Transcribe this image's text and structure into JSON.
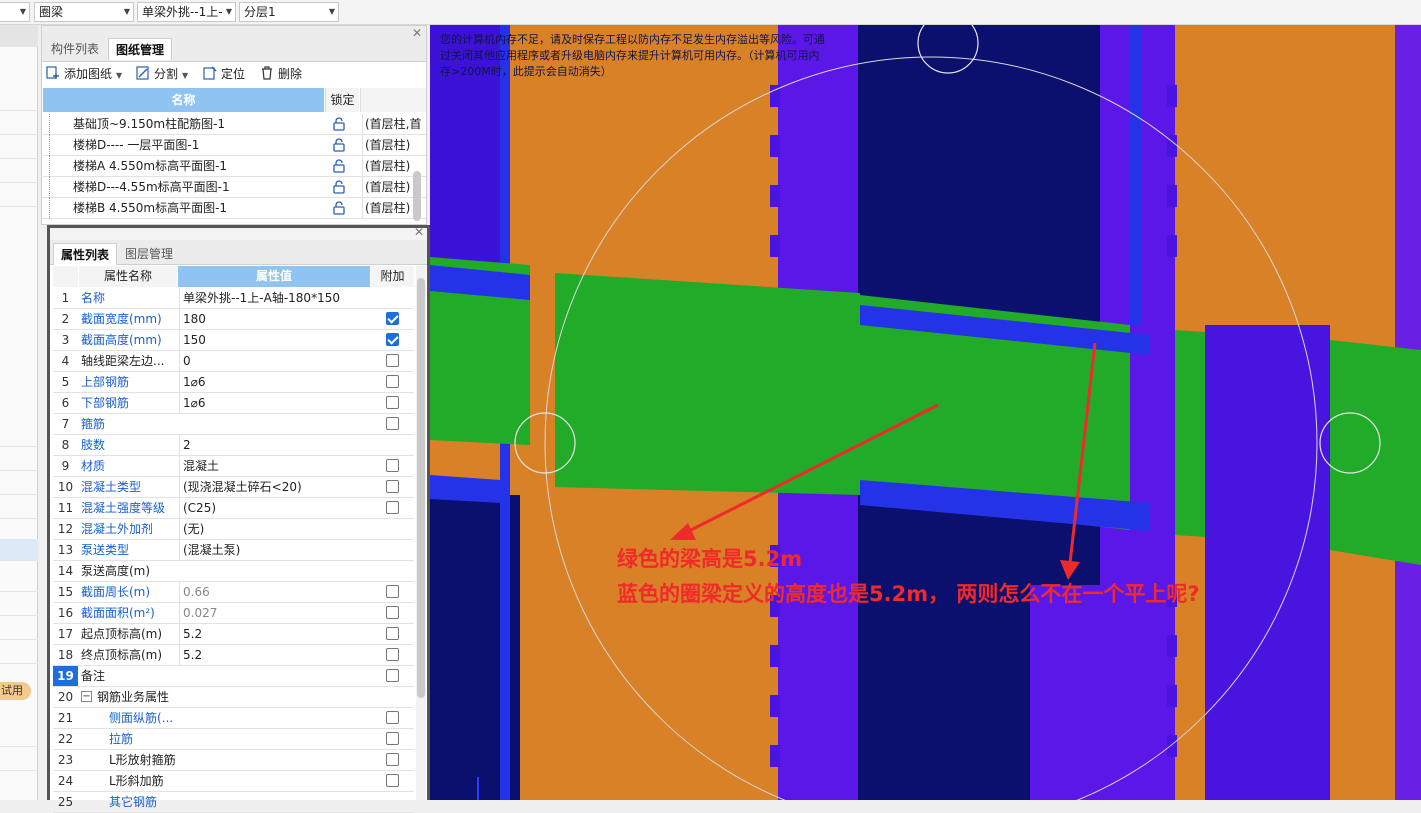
{
  "toolbar": {
    "dropdowns": [
      "",
      "圈梁",
      "单梁外挑--1上-",
      "分层1"
    ]
  },
  "left_strip": {
    "trial_badge": "试用"
  },
  "drawing_panel": {
    "tabs": [
      "构件列表",
      "图纸管理"
    ],
    "active_tab": "图纸管理",
    "actions": [
      {
        "label": "添加图纸",
        "icon": "add-drawing-icon"
      },
      {
        "label": "分割",
        "icon": "split-icon"
      },
      {
        "label": "定位",
        "icon": "locate-icon"
      },
      {
        "label": "删除",
        "icon": "delete-icon"
      }
    ],
    "columns": [
      "名称",
      "锁定",
      ""
    ],
    "rows": [
      {
        "name": "基础顶~9.150m柱配筋图-1",
        "extra": "(首层柱,首"
      },
      {
        "name": "楼梯D---- 一层平面图-1",
        "extra": "(首层柱)"
      },
      {
        "name": "楼梯A 4.550m标高平面图-1",
        "extra": "(首层柱)"
      },
      {
        "name": "楼梯D---4.55m标高平面图-1",
        "extra": "(首层柱)"
      },
      {
        "name": "楼梯B 4.550m标高平面图-1",
        "extra": "(首层柱)"
      }
    ]
  },
  "property_panel": {
    "tabs": [
      "属性列表",
      "图层管理"
    ],
    "active_tab": "属性列表",
    "columns": [
      "属性名称",
      "属性值",
      "附加"
    ],
    "rows": [
      {
        "idx": "1",
        "name": "名称",
        "value": "单梁外挑--1上-A轴-180*150",
        "style": "blue",
        "checkbox": "none"
      },
      {
        "idx": "2",
        "name": "截面宽度(mm)",
        "value": "180",
        "style": "blue",
        "checkbox": "checked"
      },
      {
        "idx": "3",
        "name": "截面高度(mm)",
        "value": "150",
        "style": "blue",
        "checkbox": "checked"
      },
      {
        "idx": "4",
        "name": "轴线距梁左边...",
        "value": "0",
        "style": "normal",
        "checkbox": "unchecked"
      },
      {
        "idx": "5",
        "name": "上部钢筋",
        "value": "1⌀6",
        "style": "blue",
        "checkbox": "unchecked"
      },
      {
        "idx": "6",
        "name": "下部钢筋",
        "value": "1⌀6",
        "style": "blue",
        "checkbox": "unchecked"
      },
      {
        "idx": "7",
        "name": "箍筋",
        "value": "",
        "style": "blue",
        "checkbox": "unchecked"
      },
      {
        "idx": "8",
        "name": "肢数",
        "value": "2",
        "style": "blue",
        "checkbox": "none"
      },
      {
        "idx": "9",
        "name": "材质",
        "value": "混凝土",
        "style": "blue",
        "checkbox": "unchecked"
      },
      {
        "idx": "10",
        "name": "混凝土类型",
        "value": "(现浇混凝土碎石<20)",
        "style": "blue",
        "checkbox": "unchecked"
      },
      {
        "idx": "11",
        "name": "混凝土强度等级",
        "value": "(C25)",
        "style": "blue",
        "checkbox": "unchecked"
      },
      {
        "idx": "12",
        "name": "混凝土外加剂",
        "value": "(无)",
        "style": "blue",
        "checkbox": "none"
      },
      {
        "idx": "13",
        "name": "泵送类型",
        "value": "(混凝土泵)",
        "style": "blue",
        "checkbox": "none"
      },
      {
        "idx": "14",
        "name": "泵送高度(m)",
        "value": "",
        "style": "normal",
        "checkbox": "none"
      },
      {
        "idx": "15",
        "name": "截面周长(m)",
        "value": "0.66",
        "style": "blue-gray",
        "checkbox": "unchecked"
      },
      {
        "idx": "16",
        "name": "截面面积(m²)",
        "value": "0.027",
        "style": "blue-gray",
        "checkbox": "unchecked"
      },
      {
        "idx": "17",
        "name": "起点顶标高(m)",
        "value": "5.2",
        "style": "normal",
        "checkbox": "unchecked"
      },
      {
        "idx": "18",
        "name": "终点顶标高(m)",
        "value": "5.2",
        "style": "normal",
        "checkbox": "unchecked"
      },
      {
        "idx": "19",
        "name": "备注",
        "value": "",
        "style": "normal",
        "checkbox": "unchecked",
        "selected": true
      },
      {
        "idx": "20",
        "name": "钢筋业务属性",
        "value": "",
        "style": "group",
        "checkbox": "none"
      },
      {
        "idx": "21",
        "name": "侧面纵筋(...",
        "value": "",
        "style": "child-blue",
        "checkbox": "unchecked"
      },
      {
        "idx": "22",
        "name": "拉筋",
        "value": "",
        "style": "child-blue",
        "checkbox": "unchecked"
      },
      {
        "idx": "23",
        "name": "L形放射箍筋",
        "value": "",
        "style": "child",
        "checkbox": "unchecked"
      },
      {
        "idx": "24",
        "name": "L形斜加筋",
        "value": "",
        "style": "child",
        "checkbox": "unchecked"
      },
      {
        "idx": "25",
        "name": "其它钢筋",
        "value": "",
        "style": "child-blue",
        "checkbox": "none"
      }
    ]
  },
  "viewport": {
    "warning": "您的计算机内存不足，请及时保存工程以防内存不足发生内存溢出等风险。可通过关闭其他应用程序或者升级电脑内存来提升计算机可用内存。（计算机可用内存>200M时，此提示会自动消失）",
    "annotation_line1": "绿色的梁高是5.2m",
    "annotation_line2": "蓝色的圈梁定义的高度也是5.2m，  两则怎么不在一个平上呢?",
    "colors": {
      "orange": "#d98127",
      "purple": "#5b17e8",
      "navy": "#0b0f6e",
      "blue_beam": "#2533e8",
      "green_beam": "#21ab28",
      "arrow": "#ee2a2a"
    }
  }
}
